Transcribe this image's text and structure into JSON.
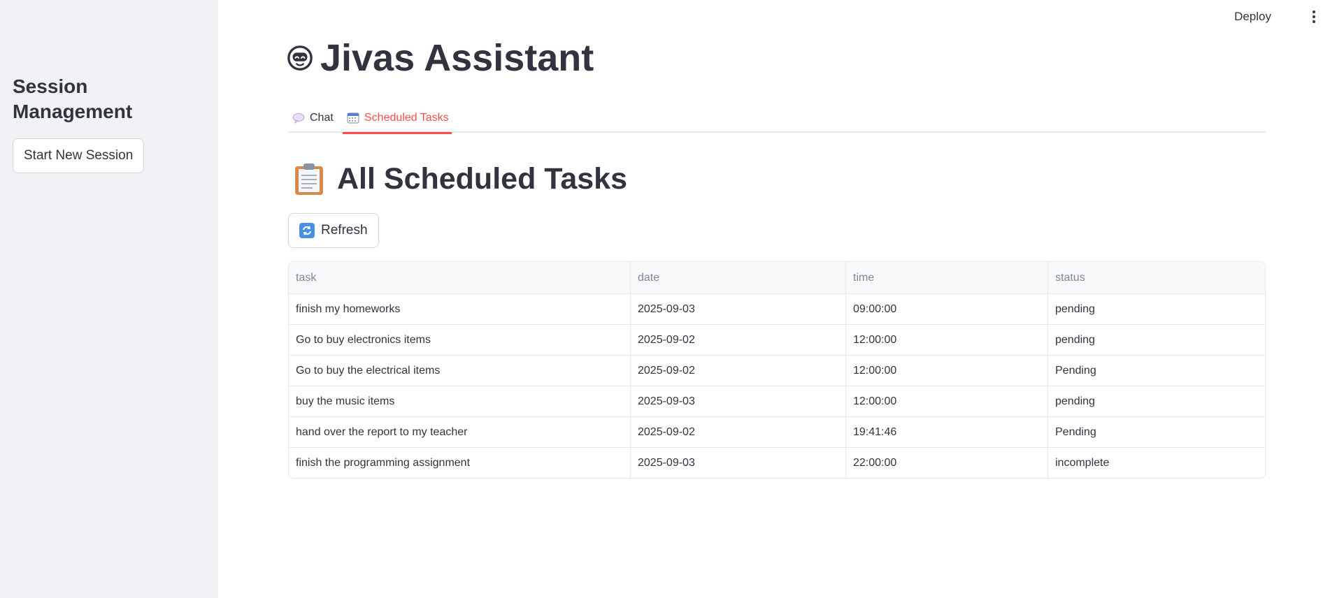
{
  "sidebar": {
    "title": "Session Management",
    "new_session_button": "Start New Session"
  },
  "header": {
    "deploy_label": "Deploy"
  },
  "app": {
    "title": "Jivas Assistant",
    "title_icon": "smiling-robot-face-icon"
  },
  "tabs": [
    {
      "label": "Chat",
      "icon": "speech-bubble-icon",
      "active": false
    },
    {
      "label": "Scheduled Tasks",
      "icon": "calendar-icon",
      "active": true
    }
  ],
  "scheduled": {
    "title": "All Scheduled Tasks",
    "title_icon": "clipboard-icon",
    "refresh_label": "Refresh",
    "refresh_icon": "refresh-arrows-icon"
  },
  "table": {
    "columns": [
      "task",
      "date",
      "time",
      "status"
    ],
    "rows": [
      [
        "finish my homeworks",
        "2025-09-03",
        "09:00:00",
        "pending"
      ],
      [
        "Go to buy electronics items",
        "2025-09-02",
        "12:00:00",
        "pending"
      ],
      [
        "Go to buy the electrical items",
        "2025-09-02",
        "12:00:00",
        "Pending"
      ],
      [
        "buy the music items",
        "2025-09-03",
        "12:00:00",
        "pending"
      ],
      [
        "hand over the report to my teacher",
        "2025-09-02",
        "19:41:46",
        "Pending"
      ],
      [
        "finish the programming assignment",
        "2025-09-03",
        "22:00:00",
        "incomplete"
      ]
    ]
  },
  "colors": {
    "accent": "#ff4b4b",
    "sidebar_bg": "#f0f2f6",
    "text": "#31333f",
    "header_text": "#808495"
  }
}
